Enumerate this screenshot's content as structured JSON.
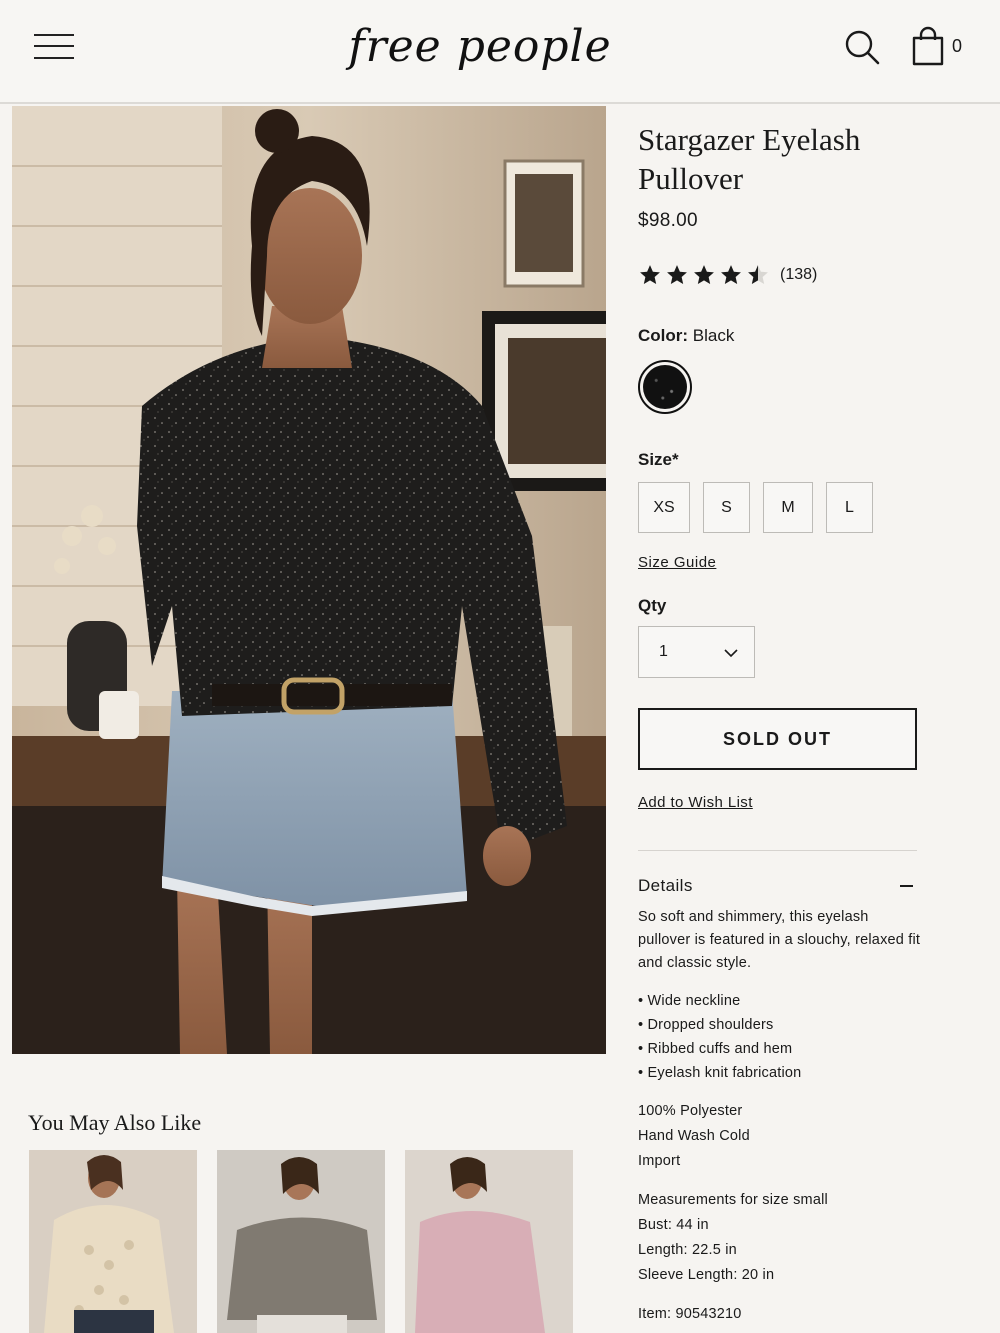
{
  "header": {
    "logo": "free people",
    "bag_count": "0",
    "icons": [
      "menu-icon",
      "search-icon",
      "shopping-bag-icon"
    ]
  },
  "product": {
    "title": "Stargazer Eyelash Pullover",
    "price": "$98.00",
    "rating": 4.5,
    "review_count": "(138)",
    "color_label": "Color:",
    "color_value": "Black",
    "size_label": "Size*",
    "sizes": [
      "XS",
      "S",
      "M",
      "L"
    ],
    "size_guide": "Size Guide",
    "qty_label": "Qty",
    "qty_value": "1",
    "sold_out": "SOLD OUT",
    "wishlist": "Add to Wish List"
  },
  "details": {
    "title": "Details",
    "description": "So soft and shimmery, this eyelash pullover is featured in a slouchy, relaxed fit and classic style.",
    "bullets": [
      "Wide neckline",
      "Dropped shoulders",
      "Ribbed cuffs and hem",
      "Eyelash knit fabrication"
    ],
    "material": "100% Polyester",
    "care": "Hand Wash Cold",
    "origin": "Import",
    "measurements_title": "Measurements for size small",
    "bust": "Bust: 44 in",
    "length": "Length: 22.5 in",
    "sleeve": "Sleeve Length: 20 in",
    "item": "Item: 90543210"
  },
  "recommendations": {
    "title": "You May Also Like"
  },
  "colors": {
    "background": "#f6f4f1",
    "text": "#1a1a1a",
    "border": "#bdbbb7"
  }
}
